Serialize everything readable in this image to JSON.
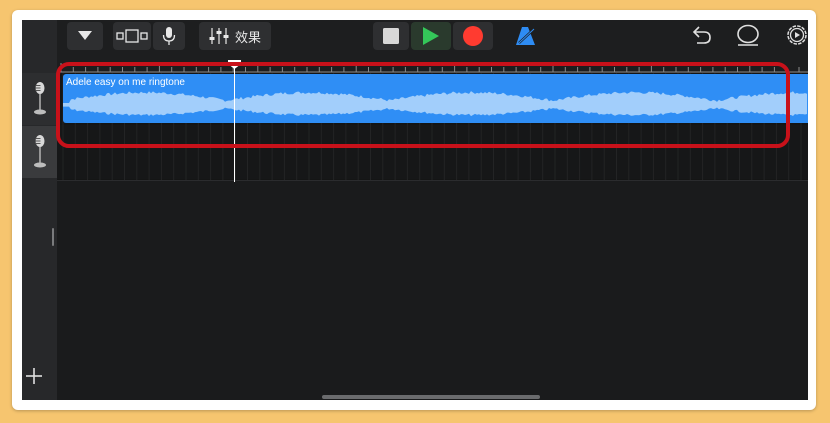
{
  "toolbar": {
    "tracks_menu_icon": "triangle-down-icon",
    "browser_icon": "track-view-toggle-icon",
    "mic_icon": "microphone-icon",
    "mixer_icon": "sliders-icon",
    "effects_label": "效果",
    "stop_icon": "stop-icon",
    "play_icon": "play-icon",
    "record_icon": "record-icon",
    "metronome_icon": "metronome-icon",
    "undo_icon": "undo-icon",
    "loop_icon": "loop-icon",
    "settings_icon": "gear-icon",
    "colors": {
      "play": "#34c759",
      "record": "#ff3b30",
      "metronome": "#2e8cf3"
    }
  },
  "tracks": [
    {
      "icon": "microphone-icon",
      "selected": false
    },
    {
      "icon": "microphone-icon",
      "selected": true
    }
  ],
  "region": {
    "name": "Adele easy on me ringtone",
    "color": "#2f8ef5"
  },
  "annotation": {
    "color": "#c8111a"
  },
  "add_track_icon": "plus-icon"
}
